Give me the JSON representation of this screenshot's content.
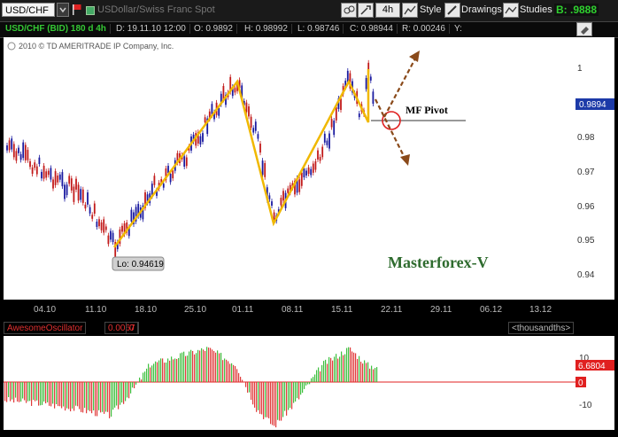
{
  "toolbar": {
    "symbol": "USD/CHF",
    "instrument_name": "USDollar/Swiss Franc Spot",
    "timeframe": "4h",
    "style_label": "Style",
    "drawings_label": "Drawings",
    "studies_label": "Studies",
    "bid_label": "B: .9888"
  },
  "infobar": {
    "symbol": "USD/CHF (BID) 180 d 4h",
    "date": "D: 19.11.10 12:00",
    "open": "O: 0.9892",
    "high": "H: 0.98992",
    "low": "L: 0.98746",
    "close": "C: 0.98944",
    "range": "R: 0.00246",
    "y": "Y:"
  },
  "chart": {
    "copyright": "2010 © TD AMERITRADE IP Company, Inc.",
    "price_ticks": [
      "1",
      "0.98",
      "0.97",
      "0.96",
      "0.95",
      "0.94"
    ],
    "date_ticks": [
      "04.10",
      "11.10",
      "18.10",
      "25.10",
      "01.11",
      "08.11",
      "15.11",
      "22.11",
      "29.11",
      "06.12",
      "13.12"
    ],
    "low_label": "Lo: 0.94619",
    "pivot_label": "MF Pivot",
    "watermark": "Masterforex-V",
    "last_price_tag": "0.9894"
  },
  "oscillator": {
    "name": "AwesomeOscillator",
    "value": "0.0067",
    "zero": "0",
    "units": "<thousandths>",
    "ticks": [
      "10",
      "0",
      "-10"
    ],
    "value_tag": "6.6804",
    "zero_tag": "0"
  },
  "colors": {
    "bull": "#1a1aa0",
    "bear": "#c21a1a",
    "zigzag": "#f0b800",
    "arrow": "#8a4a1a",
    "osc_up": "#3fbf3f",
    "osc_down": "#e03a3a",
    "bid": "#2fd12f"
  }
}
